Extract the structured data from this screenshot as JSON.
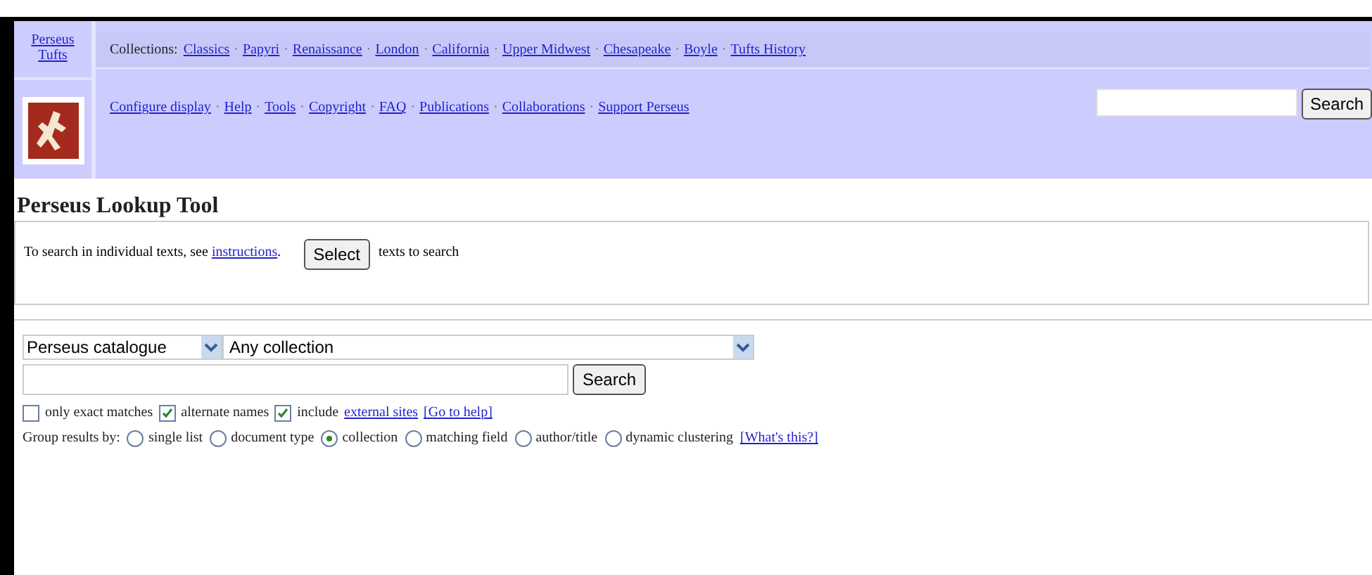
{
  "header": {
    "home_link": "Perseus Tufts",
    "collections_label": "Collections:",
    "separator": "·",
    "collections": [
      "Classics",
      "Papyri",
      "Renaissance",
      "London",
      "California",
      "Upper Midwest",
      "Chesapeake",
      "Boyle",
      "Tufts History"
    ],
    "nav_links": [
      "Configure display",
      "Help",
      "Tools",
      "Copyright",
      "FAQ",
      "Publications",
      "Collaborations",
      "Support Perseus"
    ],
    "search_button": "Search"
  },
  "title": "Perseus Lookup Tool",
  "instructions": {
    "text": "To search in individual texts, see",
    "link": "instructions",
    "link_end": ".",
    "select_button": "Select",
    "after": "texts to search"
  },
  "lookup": {
    "catalogue_select": "Perseus catalogue",
    "collection_select": "Any collection",
    "search_button": "Search",
    "options": [
      {
        "label": "only exact matches",
        "checked": false
      },
      {
        "label": "alternate names",
        "checked": true
      },
      {
        "label": "include",
        "checked": true,
        "link": "external sites"
      }
    ],
    "help_link": "[Go to help]",
    "group_label": "Group results by:",
    "group_options": [
      {
        "label": "single list",
        "selected": false
      },
      {
        "label": "document type",
        "selected": false
      },
      {
        "label": "collection",
        "selected": true
      },
      {
        "label": "matching field",
        "selected": false
      },
      {
        "label": "author/title",
        "selected": false
      },
      {
        "label": "dynamic clustering",
        "selected": false
      }
    ],
    "whats_this": "[What's this?]"
  }
}
